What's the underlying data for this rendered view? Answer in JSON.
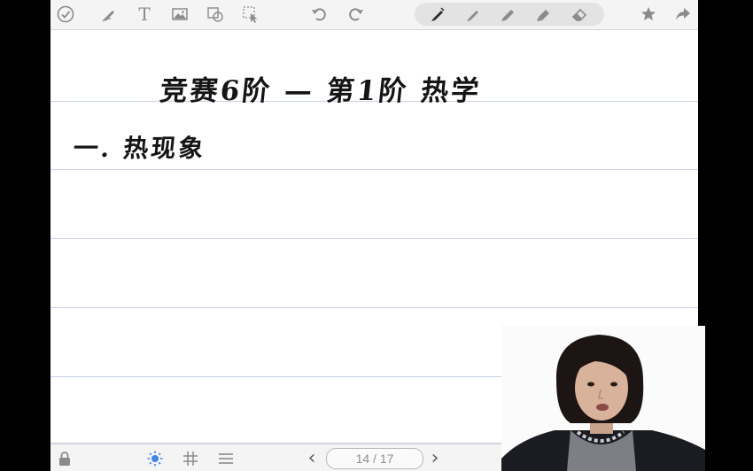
{
  "document": {
    "title_line": "竞赛6阶 — 第1阶 热学",
    "heading_line": "一. 热现象"
  },
  "toolbar": {
    "left_tools": [
      "checkmark-icon",
      "pen-tool-icon",
      "text-tool-icon",
      "image-icon",
      "shape-select-icon",
      "lasso-select-icon"
    ],
    "text_tool_label": "T",
    "history": [
      "undo-icon",
      "redo-icon"
    ],
    "pens": [
      "fountain-pen-icon",
      "pen-icon",
      "marker-icon",
      "highlighter-icon",
      "eraser-icon"
    ],
    "right_tools": [
      "star-icon",
      "share-icon"
    ]
  },
  "bottombar": {
    "page_indicator": "14 / 17",
    "left_icons": [
      "lock-icon",
      "brightness-icon",
      "grid-icon",
      "lines-icon"
    ],
    "prev_label": "‹",
    "next_label": "›"
  },
  "colors": {
    "ink": "#151515",
    "rule_line": "#c9d3e6",
    "toolbar_bg": "#f4f4f4",
    "icon_gray": "#8b8b8b",
    "accent_brightness": "#3f87e6"
  },
  "webcam": {
    "content": "presenter video overlay"
  }
}
